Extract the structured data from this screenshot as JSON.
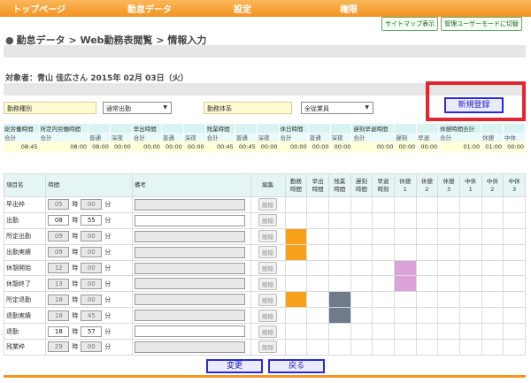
{
  "nav": [
    "トップページ",
    "勤怠データ",
    "設定",
    "権限"
  ],
  "top_buttons": {
    "sitemap": "サイトマップ表示",
    "admin": "管理ユーザーモードに切替"
  },
  "breadcrumb": "勤怠データ > Web勤務表閲覧 > 情報入力",
  "target": "対象者：青山 佳広さん 2015年 02月 03日（火）",
  "selectors": {
    "work_type_label": "勤務種別",
    "work_type_value": "通常出勤",
    "work_system_label": "勤務体系",
    "work_system_value": "全従業員",
    "new_button": "新規登録"
  },
  "summary": {
    "groups": [
      "総労働時間",
      "所定内労働時間",
      "",
      "",
      "早出時間",
      "",
      "",
      "残業時間",
      "",
      "",
      "休日時間",
      "",
      "",
      "遅刻早退時間",
      "",
      "",
      "休憩時間合計",
      "",
      ""
    ],
    "subheaders": [
      "合計",
      "合計",
      "普通",
      "深夜",
      "合計",
      "普通",
      "深夜",
      "合計",
      "普通",
      "深夜",
      "合計",
      "普通",
      "深夜",
      "合計",
      "遅刻",
      "早退",
      "合計",
      "休憩",
      "中休"
    ],
    "values": [
      "08:45",
      "08:00",
      "08:00",
      "00:00",
      "00:00",
      "00:00",
      "00:00",
      "00:45",
      "00:45",
      "00:00",
      "00:00",
      "00:00",
      "00:00",
      "00:00",
      "00:00",
      "00:00",
      "01:00",
      "01:00",
      "00:00"
    ]
  },
  "grid": {
    "headers": {
      "item": "項目名",
      "time": "時間",
      "remark": "備考",
      "edit": "編集",
      "cols": [
        "勤務\n時間",
        "早出\n時間",
        "残業\n時間",
        "遅刻\n時間",
        "早退\n時刻",
        "休憩\n1",
        "休憩\n2",
        "休憩\n3",
        "中休\n1",
        "中休\n2",
        "中休\n3"
      ]
    },
    "unit_h": "時",
    "unit_m": "分",
    "delete": "削除",
    "rows": [
      {
        "name": "早出枠",
        "h": "05",
        "m": "00",
        "enabled": false
      },
      {
        "name": "出勤",
        "h": "08",
        "m": "55",
        "enabled": true
      },
      {
        "name": "所定出勤",
        "h": "09",
        "m": "00",
        "enabled": false
      },
      {
        "name": "出勤実績",
        "h": "09",
        "m": "00",
        "enabled": false
      },
      {
        "name": "休憩開始",
        "h": "12",
        "m": "00",
        "enabled": false
      },
      {
        "name": "休憩終了",
        "h": "13",
        "m": "00",
        "enabled": false
      },
      {
        "name": "所定退勤",
        "h": "18",
        "m": "00",
        "enabled": false
      },
      {
        "name": "退勤実績",
        "h": "18",
        "m": "45",
        "enabled": false
      },
      {
        "name": "退勤",
        "h": "18",
        "m": "57",
        "enabled": true
      },
      {
        "name": "残業枠",
        "h": "29",
        "m": "00",
        "enabled": false
      }
    ],
    "colors": {
      "orange": "#f7a11a",
      "pink": "#dda2d9",
      "slate": "#6d7b8a"
    }
  },
  "bottom": {
    "change": "変更",
    "back": "戻る"
  }
}
